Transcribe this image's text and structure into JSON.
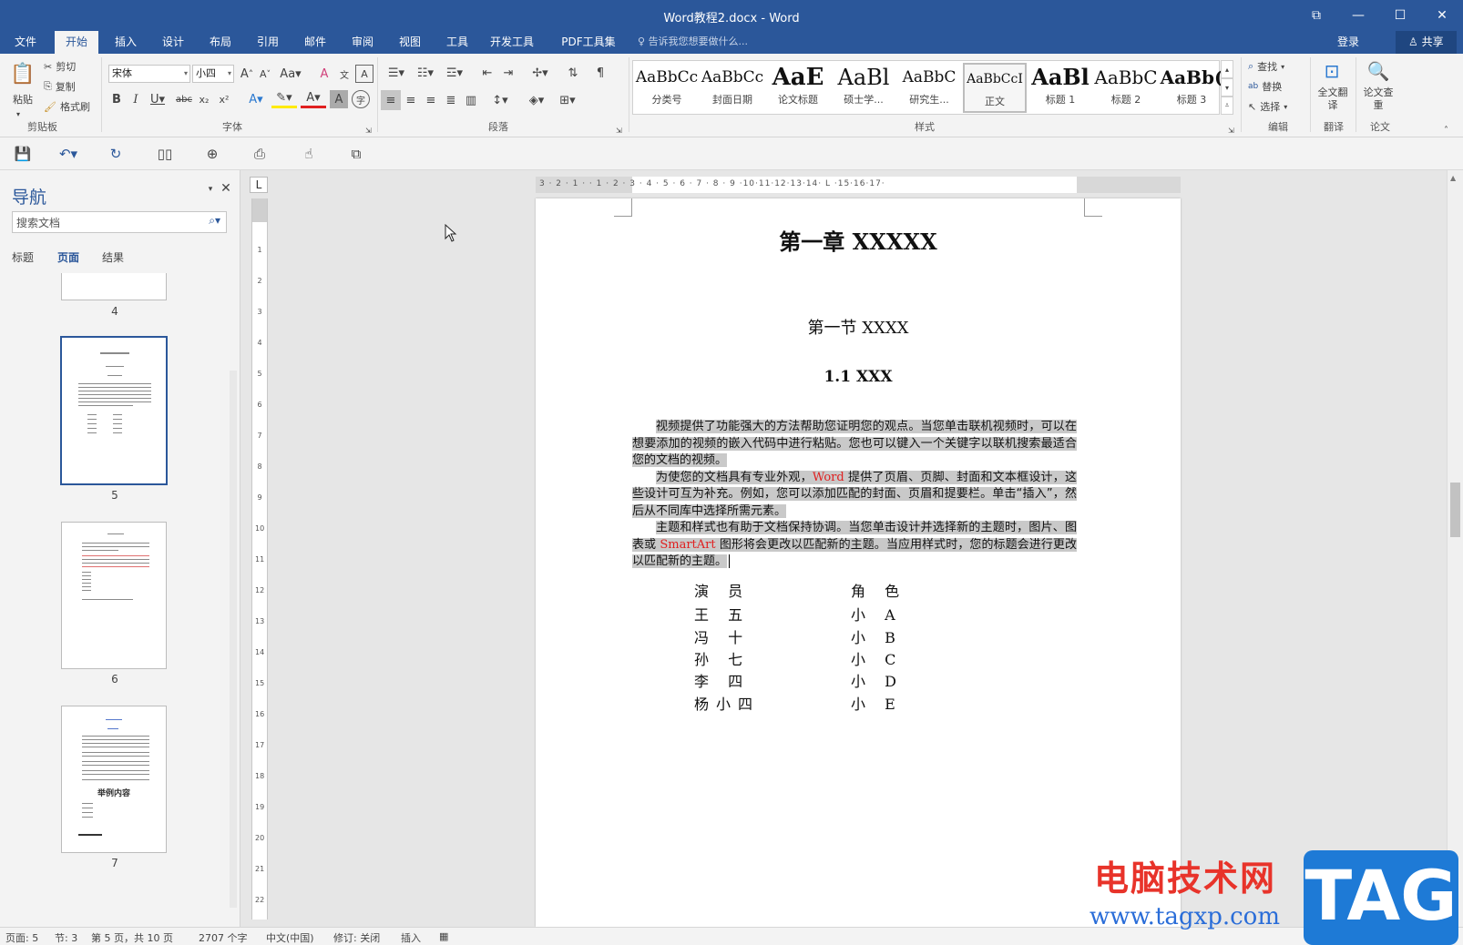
{
  "window": {
    "title": "Word教程2.docx - Word",
    "controls": [
      "⧉",
      "—",
      "☐",
      "✕"
    ]
  },
  "tabs": [
    "文件",
    "开始",
    "插入",
    "设计",
    "布局",
    "引用",
    "邮件",
    "审阅",
    "视图",
    "工具",
    "开发工具",
    "PDF工具集"
  ],
  "active_tab": "开始",
  "tell_me": "告诉我您想要做什么...",
  "account": {
    "login": "登录",
    "share": "共享"
  },
  "ribbon": {
    "clipboard": {
      "paste": "粘贴",
      "cut": "剪切",
      "copy": "复制",
      "format_painter": "格式刷",
      "label": "剪贴板"
    },
    "font": {
      "name": "宋体",
      "size": "小四",
      "label": "字体"
    },
    "paragraph": {
      "label": "段落"
    },
    "styles": {
      "label": "样式",
      "items": [
        {
          "sample": "AaBbCc",
          "name": "分类号"
        },
        {
          "sample": "AaBbCc",
          "name": "封面日期"
        },
        {
          "sample": "AaE",
          "name": "论文标题"
        },
        {
          "sample": "AaBl",
          "name": "硕士学..."
        },
        {
          "sample": "AaBbC",
          "name": "研究生..."
        },
        {
          "sample": "AaBbCcI",
          "name": "正文"
        },
        {
          "sample": "AaBl",
          "name": "标题 1"
        },
        {
          "sample": "AaBbC",
          "name": "标题 2"
        },
        {
          "sample": "AaBb(",
          "name": "标题 3"
        }
      ]
    },
    "editing": {
      "find": "查找",
      "replace": "替换",
      "select": "选择",
      "label": "编辑"
    },
    "translate": {
      "button": "全文翻译",
      "label": "翻译"
    },
    "paper": {
      "button": "论文查重",
      "label": "论文"
    }
  },
  "navigation": {
    "title": "导航",
    "search_placeholder": "搜索文档",
    "tabs": [
      "标题",
      "页面",
      "结果"
    ],
    "active_tab": "页面",
    "pages": [
      "4",
      "5",
      "6",
      "7"
    ],
    "selected_page": "5",
    "page7_heading": "举例内容"
  },
  "ruler": {
    "horizontal": "3 · 2 · 1 ·   · 1 · 2 · 3 · 4 · 5 · 6 · 7 · 8 · 9 ·10·11·12·13·14· L ·15·16·17·",
    "vertical": [
      "1",
      "2",
      "3",
      "4",
      "5",
      "6",
      "7",
      "8",
      "9",
      "10",
      "11",
      "12",
      "13",
      "14",
      "15",
      "16",
      "17",
      "18",
      "19",
      "20",
      "21",
      "22"
    ],
    "tab_selector": "L"
  },
  "document": {
    "chapter": "第一章  XXXXX",
    "section": "第一节  XXXX",
    "subsection": "1.1 XXX",
    "p1": "视频提供了功能强大的方法帮助您证明您的观点。当您单击联机视频时，可以在想要添加的视频的嵌入代码中进行粘贴。您也可以键入一个关键字以联机搜索最适合您的文档的视频。",
    "p2_a": "为使您的文档具有专业外观，",
    "p2_word": "Word",
    "p2_b": " 提供了页眉、页脚、封面和文本框设计，这些设计可互为补充。例如，您可以添加匹配的封面、页眉和提要栏。单击“插入”，然后从不同库中选择所需元素。",
    "p3_a": "主题和样式也有助于文档保持协调。当您单击设计并选择新的主题时，图片、图表或 ",
    "p3_smartart": "SmartArt",
    "p3_b": " 图形将会更改以匹配新的主题。当应用样式时，您的标题会进行更改以匹配新的主题。",
    "cast": [
      {
        "actor": "演 员",
        "role": "角 色"
      },
      {
        "actor": "王 五",
        "role": "小 A"
      },
      {
        "actor": "冯 十",
        "role": "小 B"
      },
      {
        "actor": "孙 七",
        "role": "小 C"
      },
      {
        "actor": "李 四",
        "role": "小 D"
      },
      {
        "actor": "杨小四",
        "role": "小 E"
      }
    ]
  },
  "status": {
    "page": "页面: 5",
    "section": "节: 3",
    "page_of": "第 5 页，共 10 页",
    "words": "2707 个字",
    "language": "中文(中国)",
    "track": "修订: 关闭",
    "mode": "插入"
  },
  "watermark": {
    "site_name": "电脑技术网",
    "url": "www.tagxp.com",
    "tag": "TAG"
  },
  "colors": {
    "brand": "#2b579a",
    "highlight": "#c9c9c9",
    "red_text": "#e02020"
  }
}
